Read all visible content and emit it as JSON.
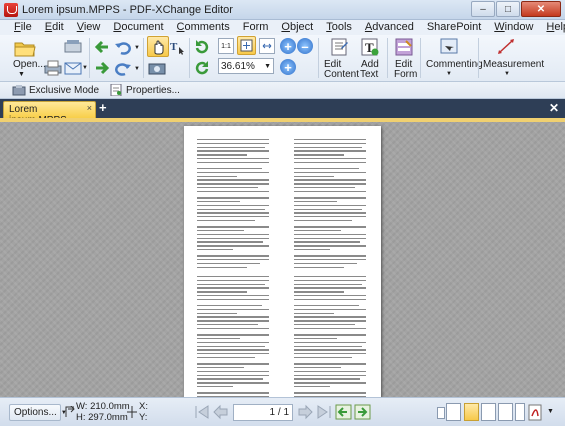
{
  "window": {
    "title": "Lorem ipsum.MPPS - PDF-XChange Editor",
    "minimize": "–",
    "maximize": "□",
    "close": "✕"
  },
  "menu": [
    {
      "u": "F",
      "rest": "ile"
    },
    {
      "u": "E",
      "rest": "dit"
    },
    {
      "u": "V",
      "rest": "iew"
    },
    {
      "u": "D",
      "rest": "ocument"
    },
    {
      "u": "C",
      "rest": "omments"
    },
    {
      "u": "",
      "rest": "Form"
    },
    {
      "u": "O",
      "rest": "bject"
    },
    {
      "u": "T",
      "rest": "ools"
    },
    {
      "u": "A",
      "rest": "dvanced"
    },
    {
      "u": "",
      "rest": "SharePoint"
    },
    {
      "u": "W",
      "rest": "indow"
    },
    {
      "u": "H",
      "rest": "elp"
    }
  ],
  "ribbon": {
    "open_label": "Open...",
    "zoom_value": "36.61%",
    "edit_content": [
      "Edit",
      "Content"
    ],
    "add_text": [
      "Add",
      "Text"
    ],
    "edit_form": [
      "Edit",
      "Form"
    ],
    "commenting": "Commenting",
    "measurement": "Measurement"
  },
  "toolbar2": {
    "exclusive_mode": "Exclusive Mode",
    "properties": "Properties..."
  },
  "tabs": {
    "active": "Lorem ipsum.MPPS",
    "close": "×",
    "add": "+",
    "close_all": "✕"
  },
  "statusbar": {
    "options": "Options...",
    "width": "W: 210.0mm",
    "height": "H: 297.0mm",
    "x": "X:",
    "y": "Y:",
    "page_current": "1",
    "page_total": "1"
  },
  "colors": {
    "tab_active": "#f8cf4a",
    "tabbar_bg": "#2e3e56",
    "doc_bg": "#a3a3a3"
  }
}
